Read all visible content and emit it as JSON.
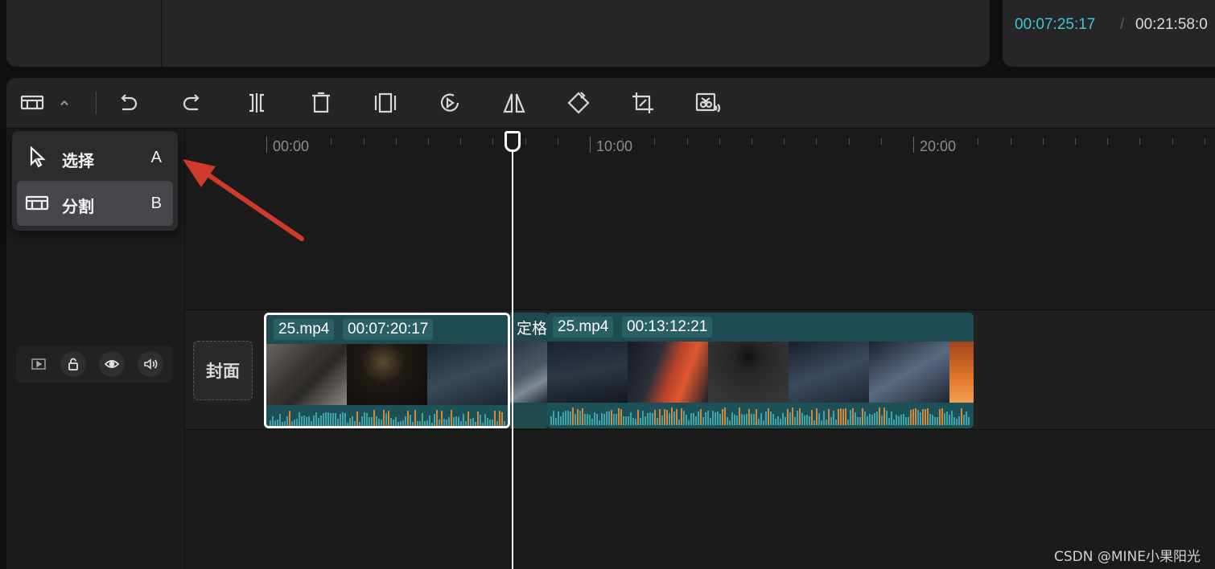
{
  "player": {
    "current_time": "00:07:25:17",
    "separator": "/",
    "total_time": "00:21:58:0"
  },
  "toolbar": {
    "items": [
      {
        "name": "split-mode-icon"
      },
      {
        "name": "chevron-up-icon"
      },
      {
        "name": "undo-icon"
      },
      {
        "name": "redo-icon"
      },
      {
        "name": "split-icon"
      },
      {
        "name": "delete-icon"
      },
      {
        "name": "freeze-frame-icon"
      },
      {
        "name": "reverse-play-icon"
      },
      {
        "name": "mirror-icon"
      },
      {
        "name": "rotate-icon"
      },
      {
        "name": "crop-icon"
      },
      {
        "name": "audio-separate-icon"
      }
    ]
  },
  "mode_menu": {
    "items": [
      {
        "label": "选择",
        "shortcut": "A",
        "icon": "cursor-icon",
        "active": false
      },
      {
        "label": "分割",
        "shortcut": "B",
        "icon": "split-mode-icon",
        "active": true
      }
    ]
  },
  "ruler": {
    "labels": [
      "00:00",
      "10:00",
      "20:00"
    ]
  },
  "track": {
    "cover_label": "封面",
    "controls": [
      "video-track-icon",
      "lock-icon",
      "eye-icon",
      "volume-icon"
    ]
  },
  "clips": [
    {
      "name": "25.mp4",
      "duration": "00:07:20:17",
      "selected": true
    },
    {
      "name": "定格"
    },
    {
      "name": "25.mp4",
      "duration": "00:13:12:21",
      "selected": false
    }
  ],
  "colors": {
    "accent_time": "#3ec7cf",
    "clip_bg": "#1e4a4f",
    "arrow": "#d03a2a"
  },
  "watermark": "CSDN @MINE小果阳光"
}
